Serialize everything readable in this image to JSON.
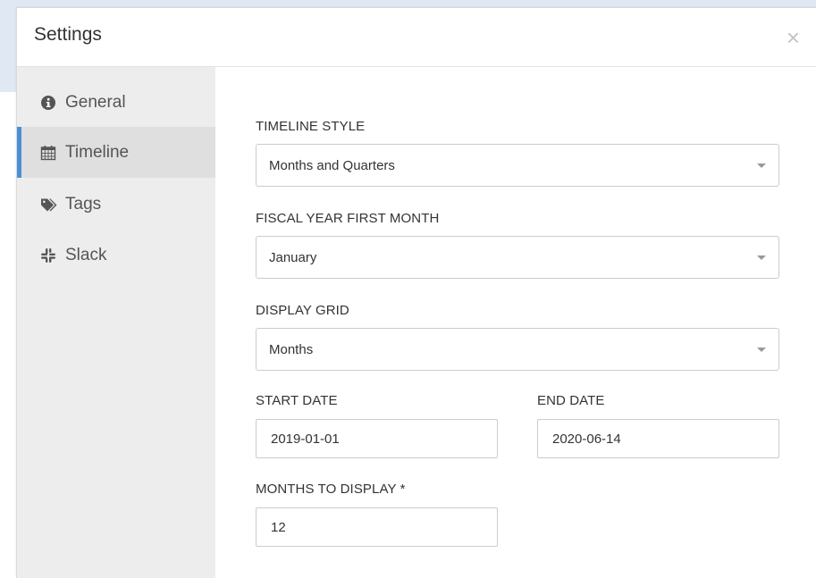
{
  "modal": {
    "title": "Settings",
    "close_label": "×"
  },
  "sidebar": {
    "items": [
      {
        "label": "General",
        "icon": "info-circle-icon",
        "active": false
      },
      {
        "label": "Timeline",
        "icon": "calendar-icon",
        "active": true
      },
      {
        "label": "Tags",
        "icon": "tags-icon",
        "active": false
      },
      {
        "label": "Slack",
        "icon": "slack-icon",
        "active": false
      }
    ],
    "active_color": "#4a8fd6"
  },
  "form": {
    "timeline_style": {
      "label": "TIMELINE STYLE",
      "value": "Months and Quarters"
    },
    "fiscal_year_first_month": {
      "label": "FISCAL YEAR FIRST MONTH",
      "value": "January"
    },
    "display_grid": {
      "label": "DISPLAY GRID",
      "value": "Months"
    },
    "start_date": {
      "label": "START DATE",
      "value": "2019-01-01"
    },
    "end_date": {
      "label": "END DATE",
      "value": "2020-06-14"
    },
    "months_to_display": {
      "label": "MONTHS TO DISPLAY *",
      "value": "12"
    }
  }
}
